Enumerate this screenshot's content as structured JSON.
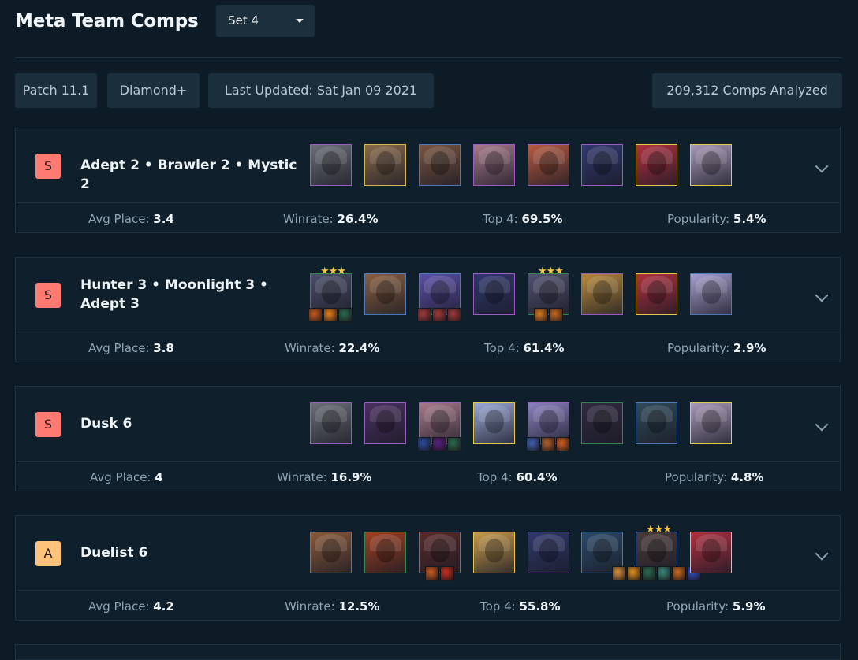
{
  "header": {
    "title": "Meta Team Comps",
    "set_select": {
      "value": "Set 4"
    }
  },
  "filters": {
    "patch": "Patch 11.1",
    "rank": "Diamond+",
    "updated": "Last Updated: Sat Jan 09 2021",
    "analyzed": "209,312 Comps Analyzed"
  },
  "stat_labels": {
    "avg": "Avg Place: ",
    "winrate": "Winrate: ",
    "top4": "Top 4: ",
    "pop": "Popularity: "
  },
  "comps": [
    {
      "tier": "S",
      "name_lines": [
        "Adept 2 • Brawler 2 • Mystic 2"
      ],
      "avg": "3.4",
      "winrate": "26.4%",
      "top4": "69.5%",
      "pop": "5.4%",
      "champs": [
        {
          "c": "#6a6f78",
          "b": "#9a5cc2"
        },
        {
          "c": "#8a6a4a",
          "b": "#d8b84a"
        },
        {
          "c": "#7a5440",
          "b": "#4a78b8"
        },
        {
          "c": "#a8798a",
          "b": "#9a5cc2"
        },
        {
          "c": "#b85a40",
          "b": "#9a5cc2"
        },
        {
          "c": "#30386e",
          "b": "#9a5cc2"
        },
        {
          "c": "#b03040",
          "b": "#e8c84a"
        },
        {
          "c": "#a898b8",
          "b": "#e8c84a"
        }
      ]
    },
    {
      "tier": "S",
      "name_lines": [
        "Hunter 3 • Moonlight 3 •",
        "Adept 3"
      ],
      "avg": "3.8",
      "winrate": "22.4%",
      "top4": "61.4%",
      "pop": "2.9%",
      "champs": [
        {
          "c": "#4a4e6a",
          "b": "#2e8a4a",
          "stars": "★★★",
          "items": [
            "#c85a20",
            "#e8801a",
            "#2a6a50"
          ]
        },
        {
          "c": "#8a6040",
          "b": "#4a78b8"
        },
        {
          "c": "#5a50a8",
          "b": "#4a78b8",
          "items": [
            "#a03a3a",
            "#a03a3a",
            "#a03a3a"
          ]
        },
        {
          "c": "#30386e",
          "b": "#9a5cc2"
        },
        {
          "c": "#505070",
          "b": "#2e8a4a",
          "stars": "★★★",
          "items": [
            "#d87a20",
            "#c86a20"
          ]
        },
        {
          "c": "#b88a3a",
          "b": "#9a5cc2"
        },
        {
          "c": "#b03040",
          "b": "#e8c84a"
        },
        {
          "c": "#a8a0d0",
          "b": "#4a78b8"
        }
      ]
    },
    {
      "tier": "S",
      "name_lines": [
        "Dusk 6"
      ],
      "avg": "4",
      "winrate": "16.9%",
      "top4": "60.4%",
      "pop": "4.8%",
      "champs": [
        {
          "c": "#6a6f78",
          "b": "#9a5cc2"
        },
        {
          "c": "#4a3060",
          "b": "#9a5cc2"
        },
        {
          "c": "#a8798a",
          "b": "#9a5cc2",
          "items": [
            "#2a4aa0",
            "#5a2080",
            "#2a6a50"
          ]
        },
        {
          "c": "#9aa8d8",
          "b": "#e8c84a"
        },
        {
          "c": "#8a80c0",
          "b": "#9a5cc2",
          "items": [
            "#4060b0",
            "#b0602a",
            "#d06020"
          ]
        },
        {
          "c": "#302a40",
          "b": "#2e8a4a"
        },
        {
          "c": "#304a5a",
          "b": "#4a78b8"
        },
        {
          "c": "#a898b8",
          "b": "#e8c84a"
        }
      ]
    },
    {
      "tier": "A",
      "name_lines": [
        "Duelist 6"
      ],
      "avg": "4.2",
      "winrate": "12.5%",
      "top4": "55.8%",
      "pop": "5.9%",
      "champs": [
        {
          "c": "#8a5a3a",
          "b": "#4a78b8"
        },
        {
          "c": "#a04020",
          "b": "#2e8a4a"
        },
        {
          "c": "#5a2a2a",
          "b": "#4a78b8",
          "items": [
            "#c85a20",
            "#c83020"
          ]
        },
        {
          "c": "#c89a4a",
          "b": "#e8c84a"
        },
        {
          "c": "#30386e",
          "b": "#9a5cc2"
        },
        {
          "c": "#2a4a6a",
          "b": "#4a78b8"
        },
        {
          "c": "#4a3a3a",
          "b": "#4a78b8",
          "stars": "★★★",
          "items": [
            "#d89040",
            "#e0901a",
            "#2a6a50",
            "#3a8a7a",
            "#c86a20",
            "#3050c0"
          ]
        },
        {
          "c": "#b03040",
          "b": "#e8c84a"
        }
      ]
    }
  ],
  "icons": {
    "chevron": "chevron-down-icon",
    "caret": "caret-down-icon"
  }
}
